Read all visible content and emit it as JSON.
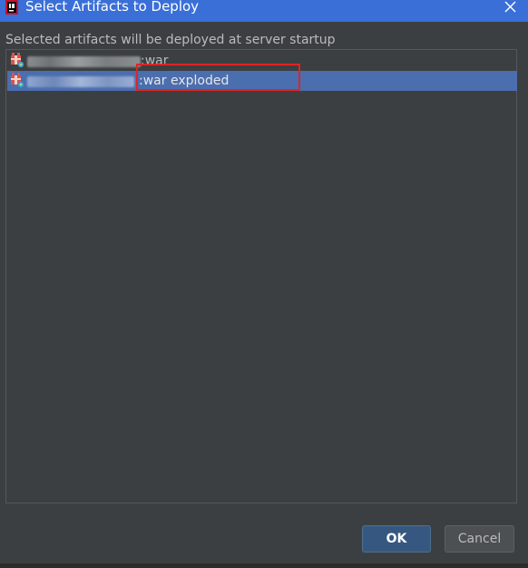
{
  "dialog": {
    "title": "Select Artifacts to Deploy",
    "close_glyph": "×"
  },
  "description": "Selected artifacts will be deployed at server startup",
  "artifacts": [
    {
      "suffix": ":war",
      "selected": false,
      "icon": "war-artifact-icon"
    },
    {
      "suffix": ":war exploded",
      "selected": true,
      "icon": "war-exploded-artifact-icon"
    }
  ],
  "buttons": {
    "ok": "OK",
    "cancel": "Cancel"
  },
  "colors": {
    "titlebar": "#3a6fd8",
    "background": "#3c3f41",
    "selection": "#4b6eaf",
    "highlight_box": "#e02424",
    "primary_button": "#365880"
  }
}
